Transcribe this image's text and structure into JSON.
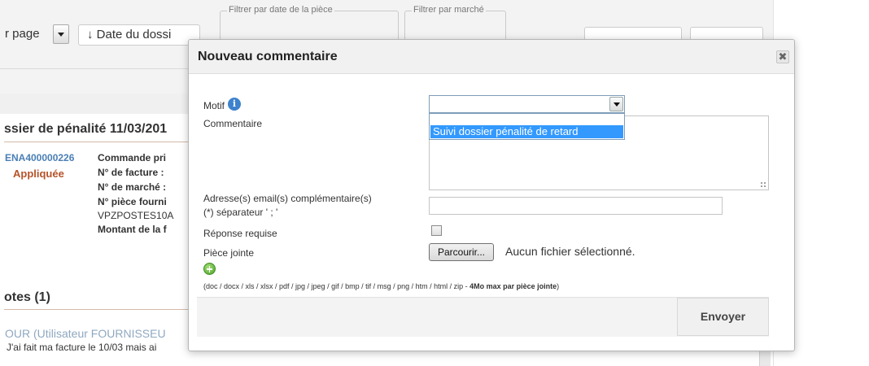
{
  "background": {
    "page_size_label": "r page",
    "sort_label": "↓ Date du dossi",
    "filter_date_legend": "Filtrer par date de la pièce",
    "filter_market_legend": "Filtrer par marché",
    "dossier_title": "ssier de pénalité 11/03/201",
    "dossier_ref": "ENA400000226",
    "dossier_status": "Appliquée",
    "details": [
      "Commande pri",
      "N° de facture :",
      "N° de marché :",
      "N° pièce fourni",
      "VPZPOSTES10A",
      "Montant de la f"
    ],
    "notes_title": "otes (1)",
    "note_author": "OUR (Utilisateur FOURNISSEU",
    "note_text": "J'ai fait ma facture le 10/03 mais ai "
  },
  "modal": {
    "title": "Nouveau commentaire",
    "close_glyph": "✖",
    "form": {
      "motif_label": "Motif",
      "info_glyph": "i",
      "motif_value": "",
      "motif_options": [
        "Suivi dossier pénalité de retard"
      ],
      "commentaire_label": "Commentaire",
      "email_label_line1": "Adresse(s) email(s) complémentaire(s)",
      "email_label_line2": "(*) séparateur ' ; '",
      "email_value": "",
      "reponse_label": "Réponse requise",
      "reponse_checked": false,
      "piece_jointe_label": "Pièce jointe",
      "browse_label": "Parcourir...",
      "no_file_text": "Aucun fichier sélectionné.",
      "allowed_types": "(doc / docx / xls / xlsx / pdf / jpg / jpeg / gif / bmp / tif / msg / png / htm / html / zip - ",
      "size_limit": "4Mo max par pièce jointe",
      "allowed_types_close": ")"
    },
    "submit_label": "Envoyer"
  },
  "colors": {
    "selection": "#3399ff",
    "info_icon": "#3d82cc",
    "status": "#b5532a",
    "link": "#4a7fb5"
  }
}
